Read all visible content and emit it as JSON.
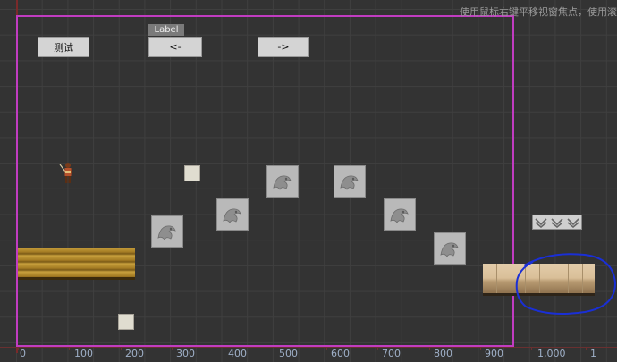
{
  "hint_text": "使用鼠标右键平移视窗焦点，使用滚",
  "buttons": {
    "test_label": "测试",
    "prev_label": "<-",
    "next_label": "->"
  },
  "label_tag": "Label",
  "x_axis_ticks": [
    "0",
    "100",
    "200",
    "300",
    "400",
    "500",
    "600",
    "700",
    "800",
    "900",
    "1,000",
    "1"
  ],
  "colors": {
    "background": "#333333",
    "grid": "#3f3f3f",
    "scene_frame": "#c13cc1",
    "annotation": "#1a2fd6",
    "axis_labels": "#9fb0c8"
  },
  "icons": {
    "character": "hero-sprite-icon",
    "dragon_brick": "dragon-relief-icon",
    "chevrons": "chevron-down-icon"
  }
}
